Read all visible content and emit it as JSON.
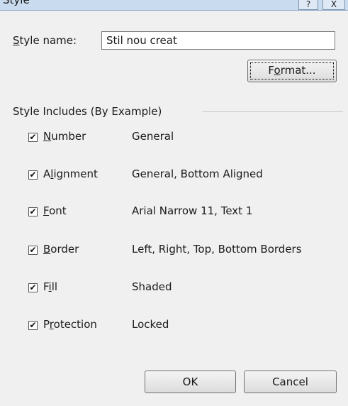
{
  "window": {
    "title": "Style"
  },
  "titlebar": {
    "help_glyph": "?",
    "close_glyph": "X"
  },
  "style_name": {
    "label_u": "S",
    "label_rest": "tyle name:",
    "value": "Stil nou creat"
  },
  "format_button": {
    "pre": "F",
    "u": "o",
    "post": "rmat..."
  },
  "includes": {
    "legend": "Style Includes (By Example)"
  },
  "options": [
    {
      "pre": "",
      "u": "N",
      "post": "umber",
      "desc": "General",
      "checked": true
    },
    {
      "pre": "A",
      "u": "l",
      "post": "ignment",
      "desc": "General, Bottom Aligned",
      "checked": true
    },
    {
      "pre": "",
      "u": "F",
      "post": "ont",
      "desc": "Arial Narrow 11, Text 1",
      "checked": true
    },
    {
      "pre": "",
      "u": "B",
      "post": "order",
      "desc": "Left, Right, Top, Bottom Borders",
      "checked": true
    },
    {
      "pre": "F",
      "u": "i",
      "post": "ll",
      "desc": "Shaded",
      "checked": true
    },
    {
      "pre": "P",
      "u": "r",
      "post": "otection",
      "desc": "Locked",
      "checked": true
    }
  ],
  "footer": {
    "ok": "OK",
    "cancel": "Cancel"
  }
}
